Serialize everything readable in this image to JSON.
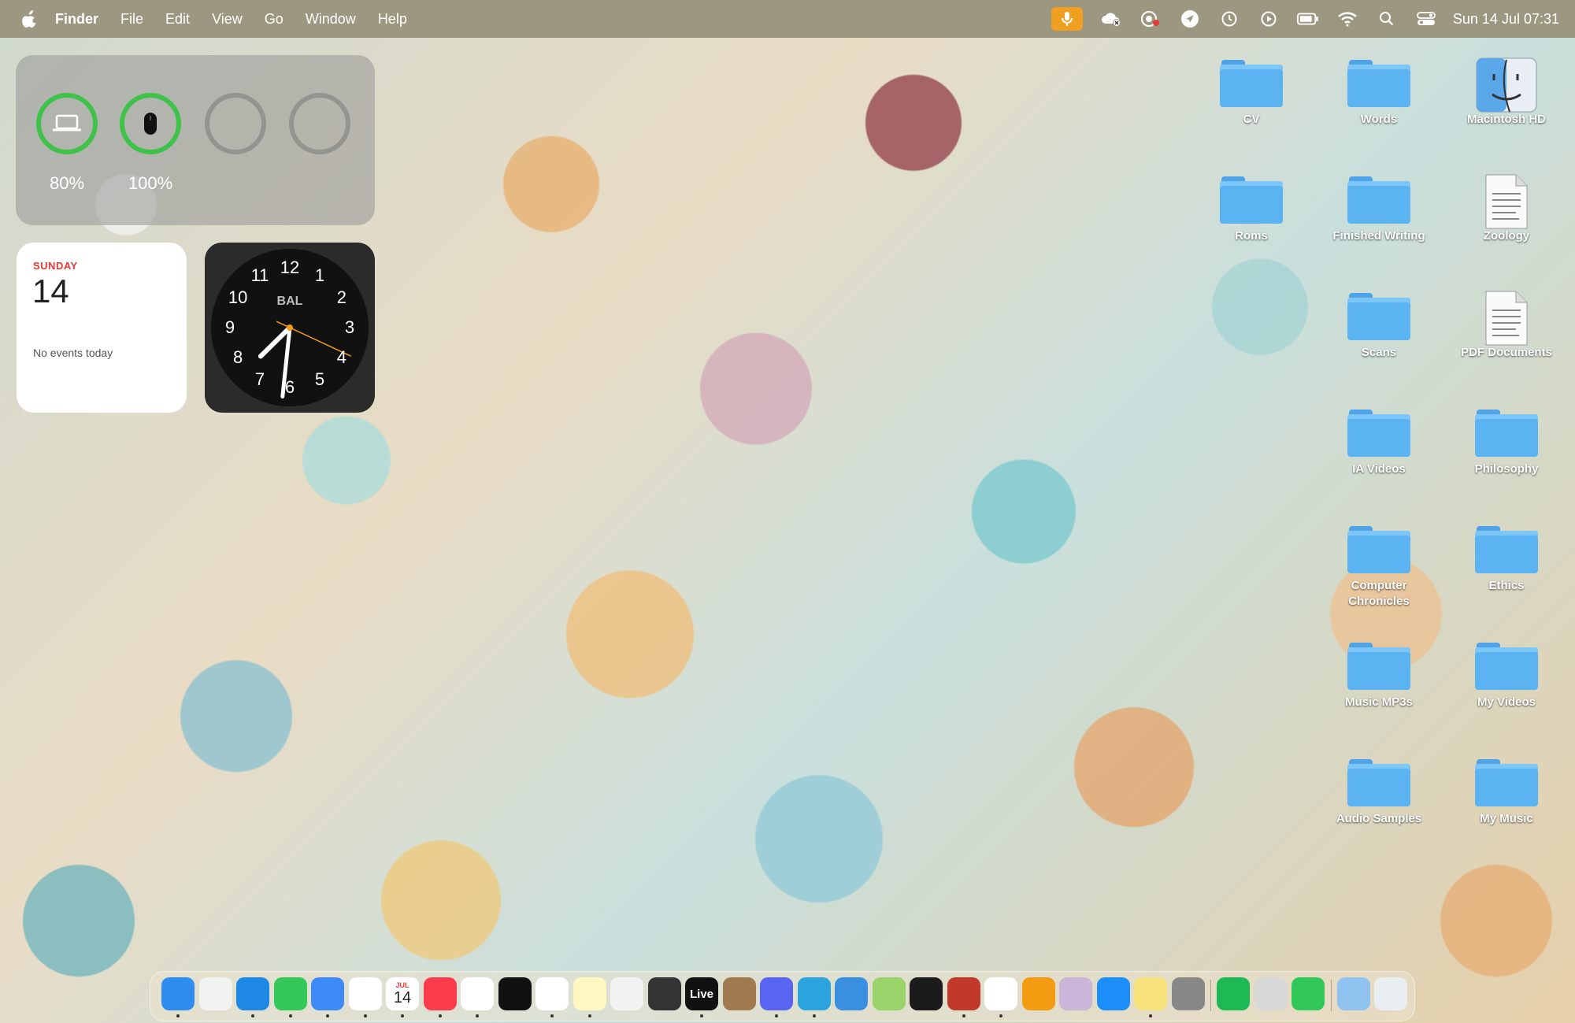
{
  "menubar": {
    "app_name": "Finder",
    "menus": [
      "File",
      "Edit",
      "View",
      "Go",
      "Window",
      "Help"
    ],
    "datetime": "Sun 14 Jul  07:31"
  },
  "status_icons": [
    "microphone-icon",
    "cloud-icon",
    "screen-recording-icon",
    "location-arrow-icon",
    "time-machine-icon",
    "play-icon",
    "battery-icon",
    "wifi-icon",
    "search-icon",
    "control-center-icon"
  ],
  "batteries": {
    "laptop_level": "80%",
    "mouse_level": "100%",
    "laptop_fraction": 0.8,
    "mouse_fraction": 1.0
  },
  "calendar_widget": {
    "day_name": "SUNDAY",
    "date": "14",
    "events": "No events today"
  },
  "clock_widget": {
    "city": "BAL",
    "numbers": [
      "12",
      "1",
      "2",
      "3",
      "4",
      "5",
      "6",
      "7",
      "8",
      "9",
      "10",
      "11"
    ],
    "time": "07:31"
  },
  "desktop_icons": [
    {
      "label": "CV",
      "type": "folder"
    },
    {
      "label": "Words",
      "type": "folder"
    },
    {
      "label": "Macintosh HD",
      "type": "drive"
    },
    {
      "label": "Roms",
      "type": "folder"
    },
    {
      "label": "Finished Writing",
      "type": "folder"
    },
    {
      "label": "Zoology",
      "type": "document"
    },
    {
      "label": "Scans",
      "type": "folder"
    },
    {
      "label": "PDF Documents",
      "type": "document"
    },
    {
      "label": "IA Videos",
      "type": "folder"
    },
    {
      "label": "Philosophy",
      "type": "folder"
    },
    {
      "label": "Computer Chronicles",
      "type": "folder"
    },
    {
      "label": "Ethics",
      "type": "folder"
    },
    {
      "label": "Music MP3s",
      "type": "folder"
    },
    {
      "label": "My Videos",
      "type": "folder"
    },
    {
      "label": "Audio Samples",
      "type": "folder"
    },
    {
      "label": "My Music",
      "type": "folder"
    }
  ],
  "dock": {
    "calendar_month": "JUL",
    "calendar_date": "14",
    "live_label": "Live",
    "apps": [
      {
        "name": "finder",
        "color": "#2f8cf0",
        "running": true
      },
      {
        "name": "launchpad",
        "color": "#f2f2f2",
        "running": false
      },
      {
        "name": "safari",
        "color": "#1e88e5",
        "running": true
      },
      {
        "name": "messages",
        "color": "#34c759",
        "running": true
      },
      {
        "name": "mail",
        "color": "#3d8af7",
        "running": true
      },
      {
        "name": "photos",
        "color": "#ffffff",
        "running": true
      },
      {
        "name": "calendar",
        "color": "#ffffff",
        "running": true
      },
      {
        "name": "music",
        "color": "#fa3c4c",
        "running": true
      },
      {
        "name": "reminders",
        "color": "#ffffff",
        "running": true
      },
      {
        "name": "apple-tv",
        "color": "#111111",
        "running": false
      },
      {
        "name": "clock",
        "color": "#ffffff",
        "running": true
      },
      {
        "name": "notes",
        "color": "#fff7c2",
        "running": true
      },
      {
        "name": "scrivener",
        "color": "#f2f2f2",
        "running": false
      },
      {
        "name": "disk-utility",
        "color": "#333333",
        "running": false
      },
      {
        "name": "live",
        "color": "#111111",
        "running": true
      },
      {
        "name": "contacts",
        "color": "#a07b4f",
        "running": false
      },
      {
        "name": "discord",
        "color": "#5865f2",
        "running": true
      },
      {
        "name": "telegram",
        "color": "#2aa3de",
        "running": true
      },
      {
        "name": "weather",
        "color": "#3b8fe0",
        "running": false
      },
      {
        "name": "maps",
        "color": "#9bd36b",
        "running": false
      },
      {
        "name": "audio-app",
        "color": "#1b1b1b",
        "running": false
      },
      {
        "name": "photo-booth",
        "color": "#c0392b",
        "running": true
      },
      {
        "name": "chrome",
        "color": "#ffffff",
        "running": true
      },
      {
        "name": "pages",
        "color": "#f39c12",
        "running": false
      },
      {
        "name": "preview",
        "color": "#c9b6d9",
        "running": false
      },
      {
        "name": "app-store",
        "color": "#1c8ef9",
        "running": false
      },
      {
        "name": "stickies",
        "color": "#f8e27c",
        "running": true
      },
      {
        "name": "system-settings",
        "color": "#888888",
        "running": false
      },
      {
        "name": "spotify",
        "color": "#1db954",
        "running": false
      },
      {
        "name": "preview-2",
        "color": "#d8d8d8",
        "running": false
      },
      {
        "name": "facetime",
        "color": "#32c759",
        "running": false
      },
      {
        "name": "downloads",
        "color": "#8fc2ee",
        "running": false
      },
      {
        "name": "trash",
        "color": "#e9eef2",
        "running": false
      }
    ]
  }
}
